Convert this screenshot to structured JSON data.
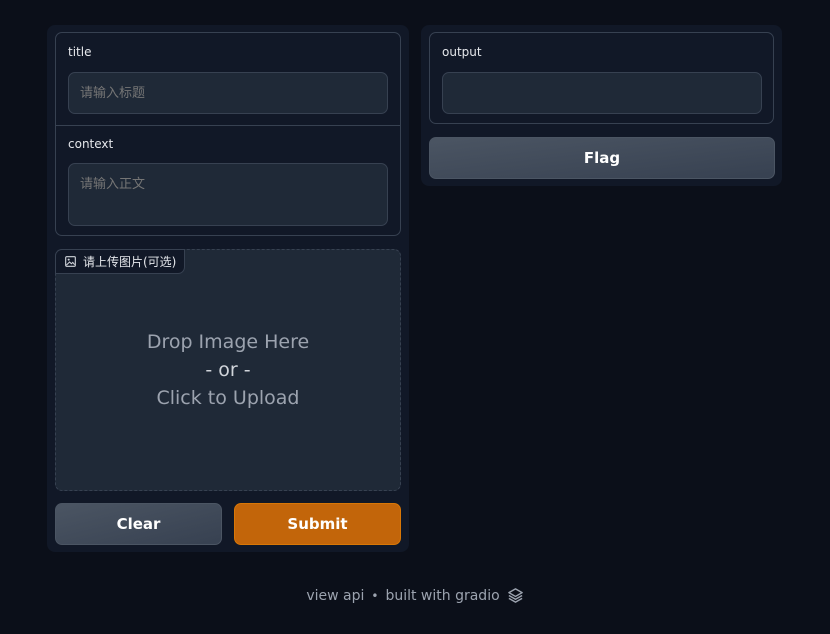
{
  "inputs": {
    "title": {
      "label": "title",
      "placeholder": "请输入标题",
      "value": ""
    },
    "context": {
      "label": "context",
      "placeholder": "请输入正文",
      "value": ""
    }
  },
  "image_upload": {
    "label": "请上传图片(可选)",
    "icon": "image-icon",
    "drop_line1": "Drop Image Here",
    "drop_line2": "- or -",
    "drop_line3": "Click to Upload"
  },
  "buttons": {
    "clear": "Clear",
    "submit": "Submit",
    "flag": "Flag"
  },
  "output": {
    "label": "output",
    "value": ""
  },
  "footer": {
    "view_api": "view api",
    "separator": "•",
    "built_with": "built with gradio",
    "logo_icon": "gradio-logo-icon"
  },
  "colors": {
    "background": "#0b0f19",
    "panel": "#111827",
    "input": "#1f2937",
    "primary": "#c2650a",
    "secondary": "#4b5563"
  }
}
